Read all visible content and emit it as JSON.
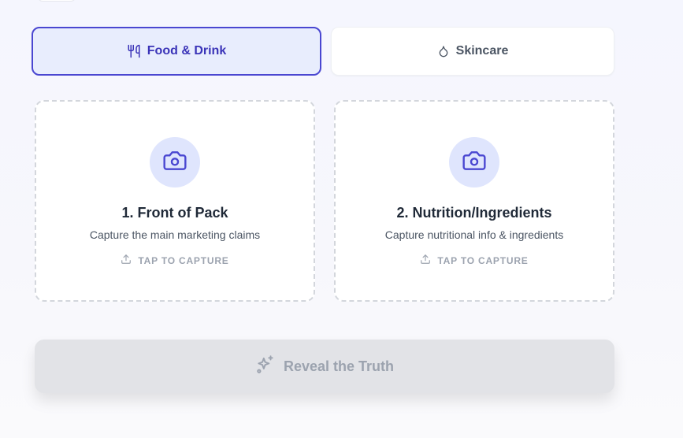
{
  "category_tabs": [
    {
      "label": "Food & Drink",
      "icon": "utensils-icon",
      "selected": true
    },
    {
      "label": "Skincare",
      "icon": "droplet-icon",
      "selected": false
    }
  ],
  "capture_cards": [
    {
      "title": "1. Front of Pack",
      "subtitle": "Capture the main marketing claims",
      "action": "TAP TO CAPTURE",
      "icon": "camera-icon"
    },
    {
      "title": "2. Nutrition/Ingredients",
      "subtitle": "Capture nutritional info & ingredients",
      "action": "TAP TO CAPTURE",
      "icon": "camera-icon"
    }
  ],
  "reveal_button": {
    "label": "Reveal the Truth",
    "icon": "sparkles-icon",
    "enabled": false
  },
  "colors": {
    "accent": "#4a47d1",
    "accent_text": "#3b34b8",
    "selected_tab_bg": "#e8edfd",
    "camera_circle_bg": "#dfe5fd",
    "disabled_button_bg": "#e2e3e7",
    "muted_text": "#9ca3af"
  }
}
